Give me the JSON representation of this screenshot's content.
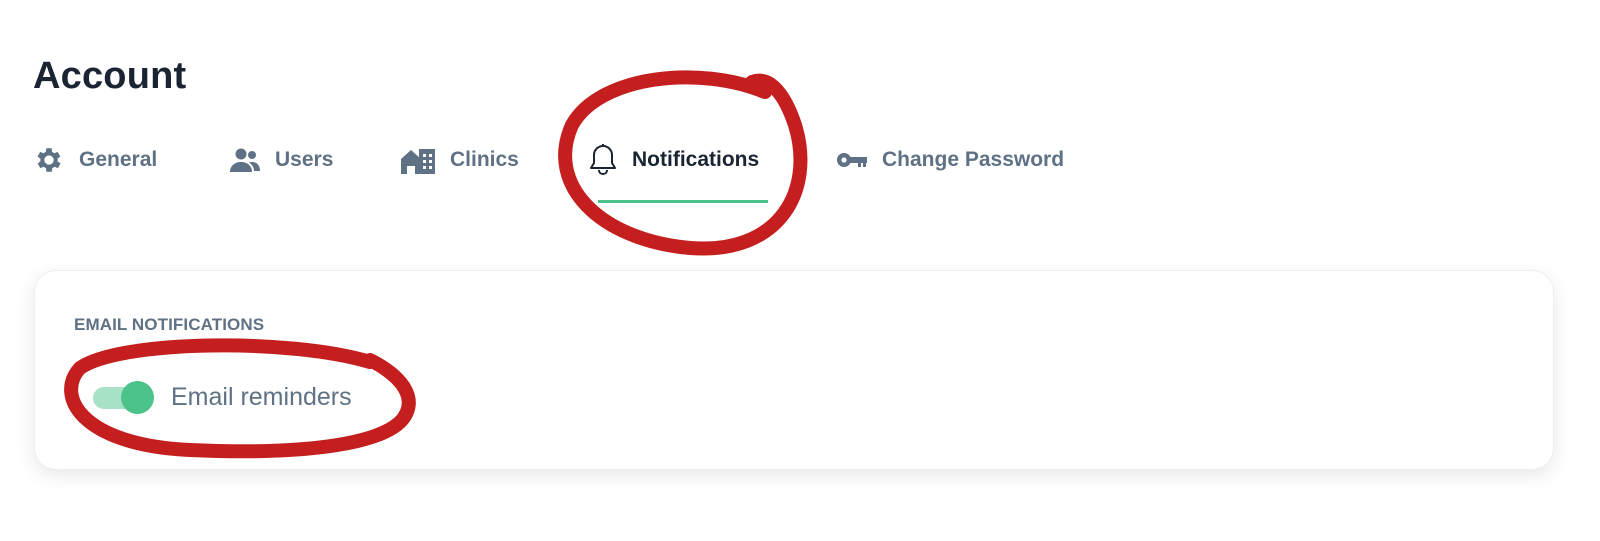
{
  "header": {
    "title": "Account"
  },
  "tabs": [
    {
      "label": "General",
      "icon": "gear-icon",
      "active": false
    },
    {
      "label": "Users",
      "icon": "users-icon",
      "active": false
    },
    {
      "label": "Clinics",
      "icon": "building-icon",
      "active": false
    },
    {
      "label": "Notifications",
      "icon": "bell-icon",
      "active": true
    },
    {
      "label": "Change Password",
      "icon": "key-icon",
      "active": false
    }
  ],
  "email_notifications": {
    "section_label": "EMAIL NOTIFICATIONS",
    "reminders": {
      "label": "Email reminders",
      "enabled": true
    }
  },
  "colors": {
    "accent": "#4cc38a",
    "text_dark": "#1b2432",
    "text_muted": "#5f7184",
    "annotation": "#c41e1e"
  }
}
